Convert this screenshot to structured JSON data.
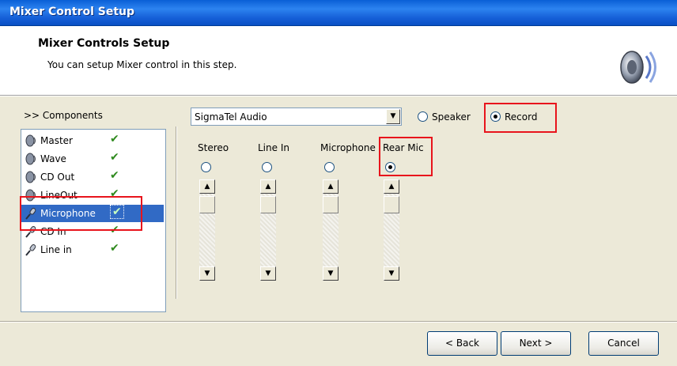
{
  "window": {
    "title": "Mixer Control Setup"
  },
  "header": {
    "title": "Mixer Controls Setup",
    "subtitle": "You can setup Mixer control in this step.",
    "icon": "speaker-icon"
  },
  "components": {
    "label": ">> Components",
    "items": [
      {
        "label": "Master",
        "icon": "speaker-icon",
        "checked": true
      },
      {
        "label": "Wave",
        "icon": "speaker-icon",
        "checked": true
      },
      {
        "label": "CD Out",
        "icon": "speaker-icon",
        "checked": true
      },
      {
        "label": "LineOut",
        "icon": "speaker-icon",
        "checked": true
      },
      {
        "label": "Microphone",
        "icon": "microphone-icon",
        "checked": true,
        "selected": true
      },
      {
        "label": "CD In",
        "icon": "microphone-icon",
        "checked": true
      },
      {
        "label": "Line in",
        "icon": "microphone-icon",
        "checked": true
      }
    ],
    "check_glyph": "✔"
  },
  "device": {
    "selected": "SigmaTel Audio"
  },
  "mode": {
    "speaker_label": "Speaker",
    "record_label": "Record",
    "selected": "Record"
  },
  "channels": [
    {
      "label": "Stereo",
      "selected": false
    },
    {
      "label": "Line In",
      "selected": false
    },
    {
      "label": "Microphone",
      "selected": false
    },
    {
      "label": "Rear Mic",
      "selected": true
    }
  ],
  "buttons": {
    "back": "< Back",
    "next": "Next >",
    "cancel": "Cancel"
  },
  "colors": {
    "title_bar": "#1660d8",
    "selection": "#316ac5",
    "highlight_box": "#e8141c",
    "check": "#2f8a1e"
  }
}
